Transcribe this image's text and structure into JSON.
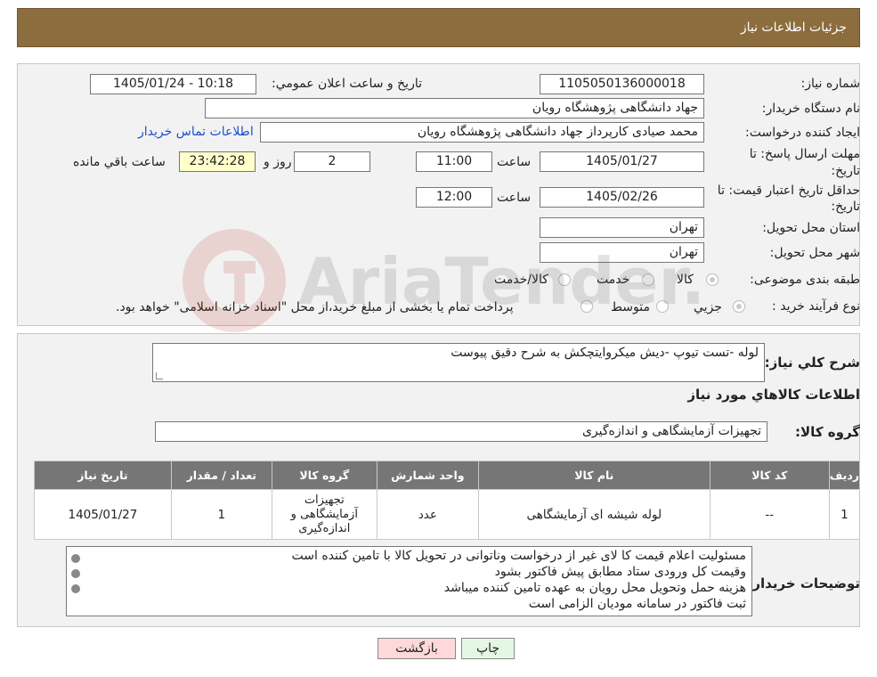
{
  "header": {
    "title": "جزئیات اطلاعات نیاز"
  },
  "form": {
    "need_number_label": "شماره نیاز:",
    "need_number": "1105050136000018",
    "announce_label": "تاریخ و ساعت اعلان عمومي:",
    "announce_value": "1405/01/24 - 10:18",
    "buyer_org_label": "نام دستگاه خریدار:",
    "buyer_org": "جهاد دانشگاهی پژوهشگاه رویان",
    "creator_label": "ایجاد کننده درخواست:",
    "creator": "محمد صیادی کارپرداز جهاد دانشگاهی پژوهشگاه رویان",
    "contact_link": "اطلاعات تماس خریدار",
    "deadline_label_1": "مهلت ارسال پاسخ: تا",
    "deadline_label_2": "تاریخ:",
    "deadline_date": "1405/01/27",
    "time_label": "ساعت",
    "deadline_time": "11:00",
    "days_value": "2",
    "days_label": "روز و",
    "remaining_time": "23:42:28",
    "remaining_label": "ساعت باقي مانده",
    "validity_label_1": "حداقل تاریخ اعتبار قیمت: تا",
    "validity_label_2": "تاریخ:",
    "validity_date": "1405/02/26",
    "validity_time": "12:00",
    "province_label": "استان محل تحویل:",
    "province": "تهران",
    "city_label": "شهر محل تحویل:",
    "city": "تهران",
    "category_label": "طبقه بندی موضوعی:",
    "category_options": [
      "کالا",
      "خدمت",
      "کالا/خدمت"
    ],
    "process_label": "نوع فرآیند خرید :",
    "process_options": [
      "جزیي",
      "متوسط"
    ],
    "process_note": "پرداخت تمام یا بخشی از مبلغ خرید،از محل \"اسناد خزانه اسلامی\" خواهد بود."
  },
  "watermark": {
    "text": "AriaTender.neT"
  },
  "description": {
    "label": "شرح کلي نیاز:",
    "text": "لوله -تست تیوپ -دیش میکروایتچکش به شرح دقیق پیوست"
  },
  "goods": {
    "section_title": "اطلاعات کالاهاي مورد نیاز",
    "group_label": "گروه کالا:",
    "group_value": "تجهیزات آزمایشگاهی و اندازه‌گیری"
  },
  "table": {
    "headers": [
      "ردیف",
      "کد کالا",
      "نام کالا",
      "واحد شمارش",
      "گروه کالا",
      "تعداد / مقدار",
      "تاریخ نیاز"
    ],
    "rows": [
      [
        "1",
        "--",
        "لوله شیشه ای آزمایشگاهی",
        "عدد",
        "تجهیزات آزمایشگاهی و اندازه‌گیری",
        "1",
        "1405/01/27"
      ]
    ]
  },
  "notes": {
    "label": "توضیحات خریدار:",
    "lines": [
      "مسئولیت اعلام قیمت کا لای  غیر از درخواست وناتوانی در تحویل کالا با تامین کننده است",
      "وقیمت کل ورودی ستاد مطابق پیش فاکتور بشود",
      "هزینه حمل وتحویل محل رویان به عهده تامین کننده میباشد",
      "ثبت فاکتور در سامانه مودیان الزامی است"
    ]
  },
  "buttons": {
    "print": "چاپ",
    "back": "بازگشت"
  },
  "colors": {
    "header_bg": "#8c6d3e",
    "table_header_bg": "#767676",
    "link": "#1a4fcc"
  }
}
